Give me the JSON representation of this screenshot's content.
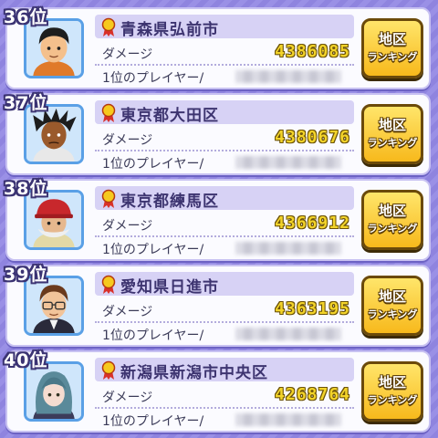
{
  "damage_label": "ダメージ",
  "player_label": "1位のプレイヤー/",
  "button": {
    "line1": "地区",
    "line2": "ランキング"
  },
  "entries": [
    {
      "rank": "36位",
      "place": "青森県弘前市",
      "damage": "4386085",
      "avatar": "boy-black-hair"
    },
    {
      "rank": "37位",
      "place": "東京都大田区",
      "damage": "4380676",
      "avatar": "spiky-hair-dark-skin"
    },
    {
      "rank": "38位",
      "place": "東京都練馬区",
      "damage": "4366912",
      "avatar": "old-man-red-cap"
    },
    {
      "rank": "39位",
      "place": "愛知県日進市",
      "damage": "4363195",
      "avatar": "man-glasses"
    },
    {
      "rank": "40位",
      "place": "新潟県新潟市中央区",
      "damage": "4268764",
      "avatar": "girl-teal-hair"
    }
  ],
  "colors": {
    "score": "#f3d42a",
    "button": "#f7b91c",
    "background": "#8f84df"
  }
}
